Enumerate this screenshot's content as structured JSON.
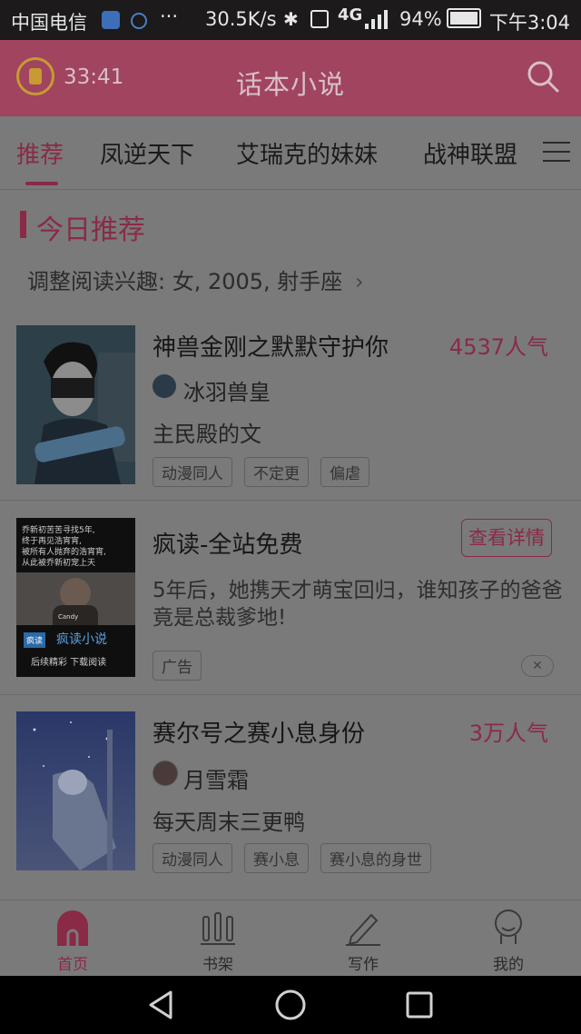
{
  "statusbar": {
    "carrier": "中国电信",
    "dots": "···",
    "speed": "30.5K/s",
    "network": "4G",
    "battery": "94%",
    "time": "下午3:04"
  },
  "appbar": {
    "timer": "33:41",
    "title": "话本小说"
  },
  "tabs": [
    {
      "label": "推荐"
    },
    {
      "label": "凤逆天下"
    },
    {
      "label": "艾瑞克的妹妹"
    },
    {
      "label": "战神联盟"
    }
  ],
  "section": {
    "title": "今日推荐",
    "interest": "调整阅读兴趣: 女, 2005, 射手座"
  },
  "books": [
    {
      "title": "神兽金刚之默默守护你",
      "popularity": "4537人气",
      "author": "冰羽兽皇",
      "desc": "主民殿的文",
      "tags": [
        "动漫同人",
        "不定更",
        "偏虐"
      ]
    },
    {
      "title": "赛尔号之赛小息身份",
      "popularity": "3万人气",
      "author": "月雪霜",
      "desc": "每天周末三更鸭",
      "tags": [
        "动漫同人",
        "赛小息",
        "赛小息的身世"
      ]
    }
  ],
  "ad": {
    "title": "疯读-全站免费",
    "button": "查看详情",
    "desc": "5年后，她携天才萌宝回归，谁知孩子的爸爸竟是总裁爹地!",
    "tag": "广告",
    "cover_lines": [
      "乔新初苦苦寻找5年,",
      "终于再见浩宵宵,",
      "被所有人抛弃的浩宵宵,",
      "从此被乔新初宠上天"
    ],
    "cover_watermark": "Candy",
    "cover_brand": "疯读小说",
    "cover_logo": "疯读",
    "cover_footer": "后续精彩 下载阅读"
  },
  "bottomnav": [
    {
      "label": "首页",
      "icon": "home-icon"
    },
    {
      "label": "书架",
      "icon": "bookshelf-icon"
    },
    {
      "label": "写作",
      "icon": "pen-icon"
    },
    {
      "label": "我的",
      "icon": "profile-icon"
    }
  ],
  "colors": {
    "accent": "#8a2a47",
    "appbar": "#a0445f",
    "background": "#7a7a7a"
  }
}
